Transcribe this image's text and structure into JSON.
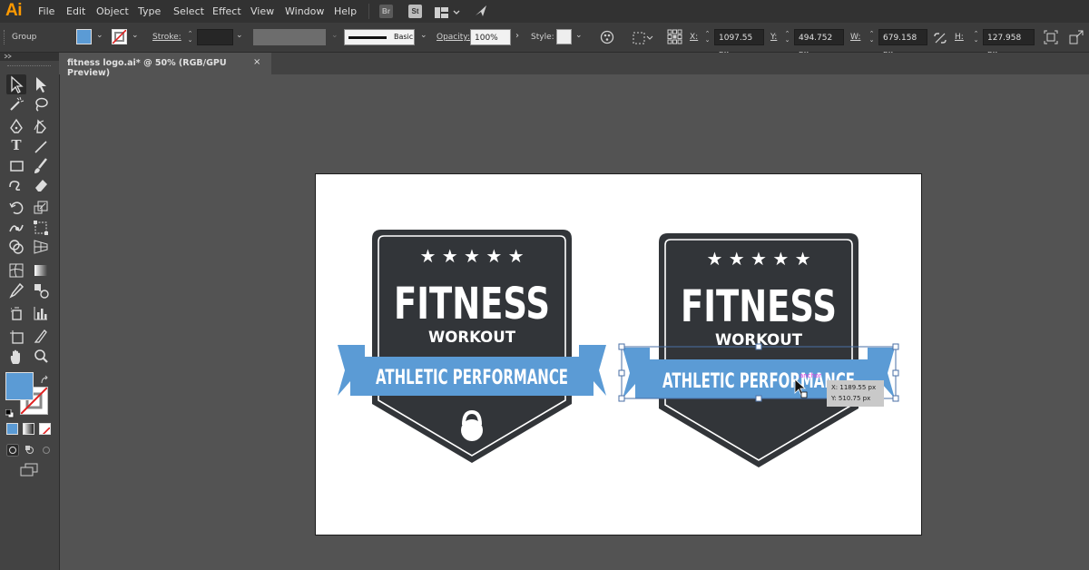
{
  "app": {
    "logo": "Ai"
  },
  "menu": {
    "items": [
      "File",
      "Edit",
      "Object",
      "Type",
      "Select",
      "Effect",
      "View",
      "Window",
      "Help"
    ]
  },
  "menubar_icons": {
    "bridge": "Br",
    "stock": "St"
  },
  "control_bar": {
    "selection_type": "Group",
    "fill_color": "#5b9bd5",
    "stroke_label": "Stroke:",
    "brush_label": "Basic",
    "opacity_label": "Opacity:",
    "opacity_value": "100%",
    "style_label": "Style:",
    "x_label": "X:",
    "x_value": "1097.55 px",
    "y_label": "Y:",
    "y_value": "494.752 px",
    "w_label": "W:",
    "w_value": "679.158 px",
    "h_label": "H:",
    "h_value": "127.958 px"
  },
  "document": {
    "tab_title": "fitness logo.ai* @ 50% (RGB/GPU Preview)",
    "close_glyph": "×"
  },
  "colors": {
    "badge": "#323539",
    "ribbon": "#5b9bd5",
    "ribbon_dark": "#2d2f33",
    "app_bg": "#535353",
    "accent": "#ff9a00"
  },
  "badges": [
    {
      "stars": "★ ★ ★ ★ ★",
      "title": "FITNESS",
      "subtitle": "WORKOUT",
      "ribbon_text": "ATHLETIC PERFORMANCE",
      "emblem": "kettlebell-icon"
    },
    {
      "stars": "★ ★ ★ ★ ★",
      "title": "FITNESS",
      "subtitle": "WORKOUT",
      "ribbon_text": "ATHLETIC PERFORMANCE"
    }
  ],
  "selection": {
    "smart_guide_label": "anchor"
  },
  "tooltip": {
    "x": "X: 1189.55 px",
    "y": "Y: 510.75 px"
  }
}
